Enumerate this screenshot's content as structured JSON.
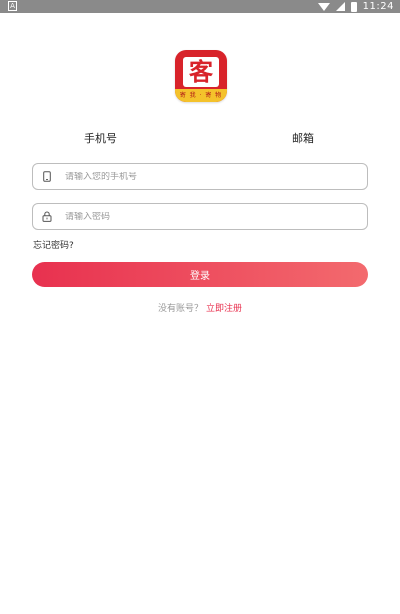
{
  "status_bar": {
    "time": "11:24",
    "icons": [
      "notification-icon",
      "wifi-icon",
      "signal-icon",
      "battery-icon"
    ]
  },
  "logo": {
    "char": "客",
    "tagline": "寄 我 · 寄 物"
  },
  "tabs": [
    {
      "label": "手机号"
    },
    {
      "label": "邮箱"
    }
  ],
  "form": {
    "phone_placeholder": "请输入您的手机号",
    "password_placeholder": "请输入密码",
    "forgot_label": "忘记密码?",
    "login_label": "登录"
  },
  "register": {
    "question": "没有账号？",
    "link": "立即注册"
  },
  "colors": {
    "accent": "#e8314f",
    "logo_red": "#d8232a",
    "logo_yellow": "#f4c22b"
  }
}
